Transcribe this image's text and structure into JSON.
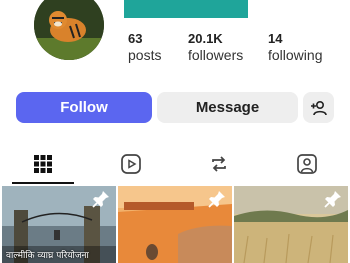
{
  "profile": {
    "avatar_icon": "tiger-avatar",
    "name_bar_color": "#1fa59a"
  },
  "stats": [
    {
      "value": "63",
      "label": "posts"
    },
    {
      "value": "20.1K",
      "label": "followers"
    },
    {
      "value": "14",
      "label": "following"
    }
  ],
  "actions": {
    "follow_label": "Follow",
    "message_label": "Message",
    "add_user_icon": "add-person-icon",
    "accent": "#5b66f0"
  },
  "tabs": [
    {
      "icon": "grid-icon",
      "active": true
    },
    {
      "icon": "reels-icon",
      "active": false
    },
    {
      "icon": "repost-icon",
      "active": false
    },
    {
      "icon": "tagged-icon",
      "active": false
    }
  ],
  "posts": [
    {
      "caption": "वाल्मीकि व्याघ्र परियोजना",
      "pinned": true
    },
    {
      "caption": "",
      "pinned": true
    },
    {
      "caption": "",
      "pinned": true
    }
  ]
}
